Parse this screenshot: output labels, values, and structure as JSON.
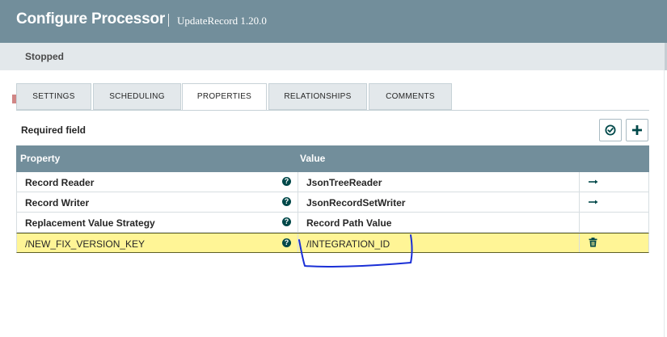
{
  "header": {
    "title": "Configure Processor",
    "subtitle": "UpdateRecord 1.20.0"
  },
  "status": {
    "icon": "stop-icon",
    "text": "Stopped",
    "color": "#d18686"
  },
  "tabs": [
    {
      "label": "SETTINGS",
      "active": false
    },
    {
      "label": "SCHEDULING",
      "active": false
    },
    {
      "label": "PROPERTIES",
      "active": true
    },
    {
      "label": "RELATIONSHIPS",
      "active": false
    },
    {
      "label": "COMMENTS",
      "active": false
    }
  ],
  "required_field_label": "Required field",
  "toolbar": {
    "verify_icon": "check-circle-icon",
    "add_icon": "plus-icon"
  },
  "table": {
    "columns": [
      "Property",
      "Value"
    ],
    "rows": [
      {
        "property": "Record Reader",
        "value": "JsonTreeReader",
        "action": "arrow-right-icon"
      },
      {
        "property": "Record Writer",
        "value": "JsonRecordSetWriter",
        "action": "arrow-right-icon"
      },
      {
        "property": "Replacement Value Strategy",
        "value": "Record Path Value",
        "action": ""
      },
      {
        "property": "/NEW_FIX_VERSION_KEY",
        "value": "/INTEGRATION_ID",
        "action": "trash-icon",
        "highlighted": true
      }
    ]
  },
  "colors": {
    "header_bg": "#728e9b",
    "status_bg": "#e3e8eb",
    "highlight_row": "#fff596",
    "icon_dark": "#004849",
    "annotation_ink": "#1a2fd6"
  }
}
